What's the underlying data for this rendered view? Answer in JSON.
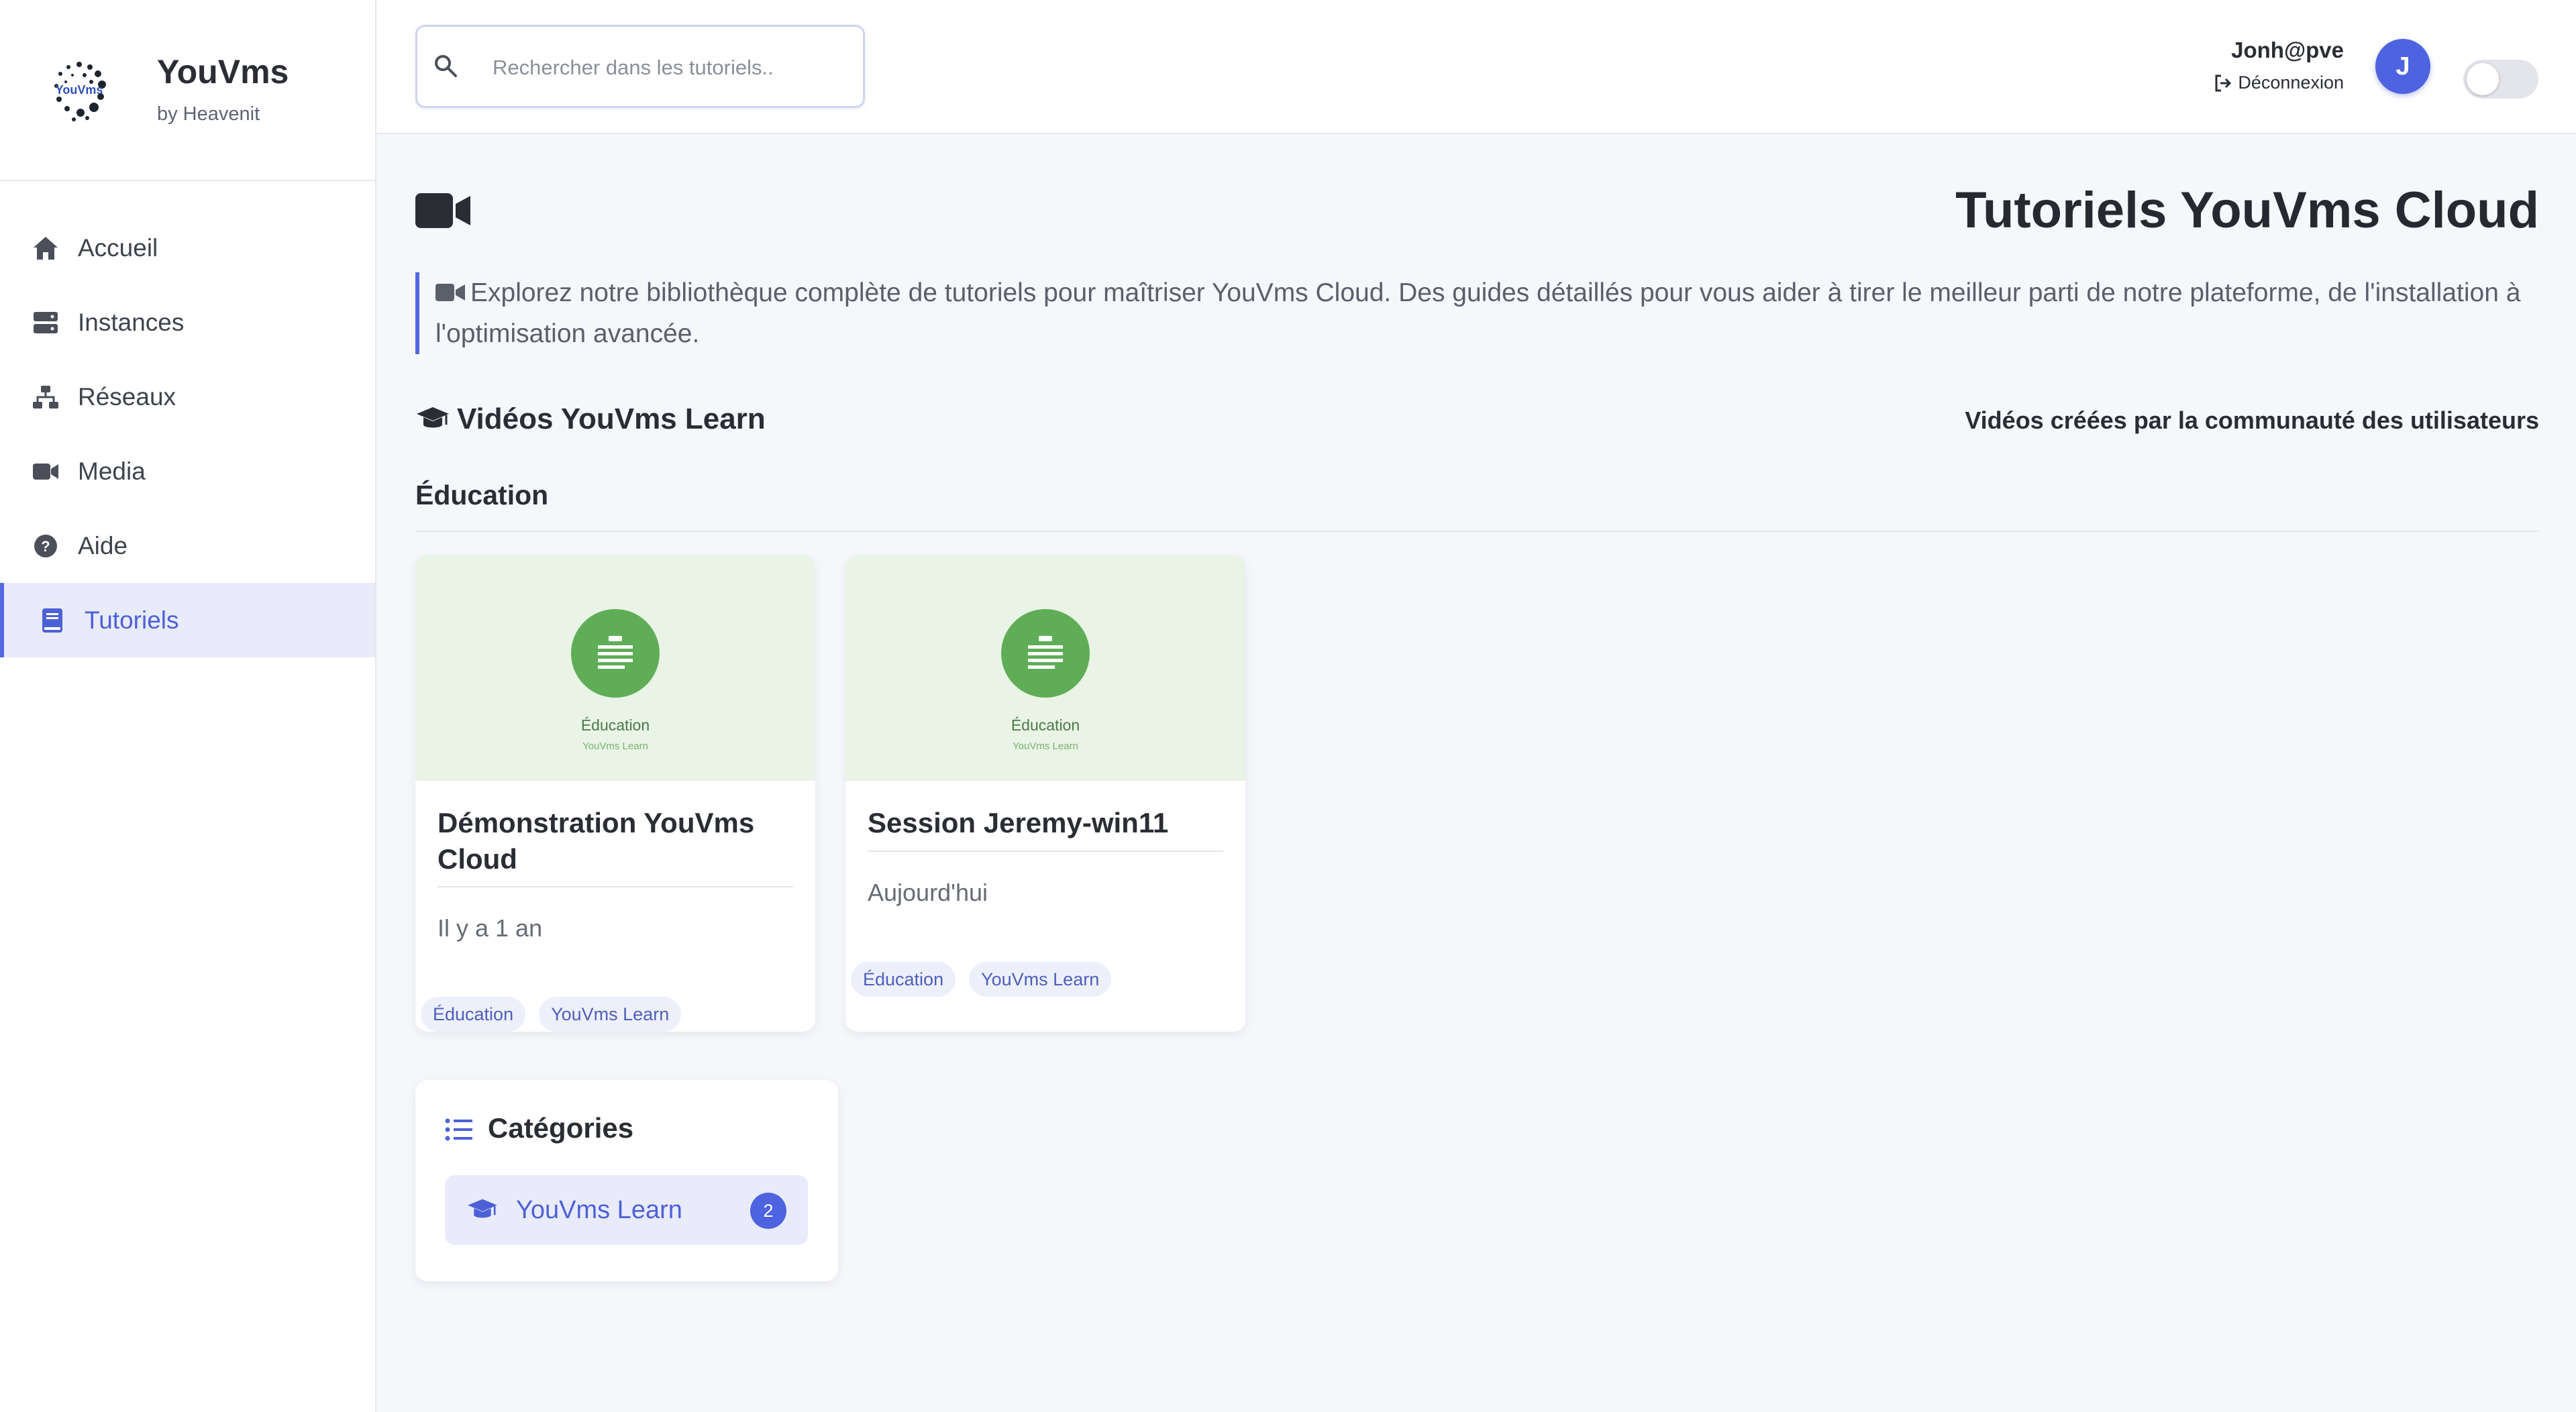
{
  "brand": {
    "name": "YouVms",
    "subtitle": "by Heavenit",
    "logo_text": "YouVms"
  },
  "sidebar": {
    "items": [
      {
        "label": "Accueil",
        "icon": "home-icon",
        "active": false
      },
      {
        "label": "Instances",
        "icon": "server-icon",
        "active": false
      },
      {
        "label": "Réseaux",
        "icon": "network-icon",
        "active": false
      },
      {
        "label": "Media",
        "icon": "video-icon",
        "active": false
      },
      {
        "label": "Aide",
        "icon": "help-icon",
        "active": false
      },
      {
        "label": "Tutoriels",
        "icon": "book-icon",
        "active": true
      }
    ]
  },
  "header": {
    "search": {
      "placeholder": "Rechercher dans les tutoriels..",
      "value": ""
    },
    "user": {
      "name": "Jonh@pve",
      "logout_label": "Déconnexion",
      "avatar_letter": "J"
    },
    "theme_toggle": {
      "on": false
    }
  },
  "main": {
    "title": "Tutoriels YouVms Cloud",
    "intro": "Explorez notre bibliothèque complète de tutoriels pour maîtriser YouVms Cloud. Des guides détaillés pour vous aider à tirer le meilleur parti de notre plateforme, de l'installation à l'optimisation avancée.",
    "section_title": "Vidéos YouVms Learn",
    "section_note": "Vidéos créées par la communauté des utilisateurs",
    "category_title": "Éducation",
    "cards": [
      {
        "thumb_category": "Éducation",
        "thumb_brand": "YouVms Learn",
        "title": "Démonstration YouVms Cloud",
        "date": "Il y a 1 an",
        "tags": [
          "Éducation",
          "YouVms Learn"
        ]
      },
      {
        "thumb_category": "Éducation",
        "thumb_brand": "YouVms Learn",
        "title": "Session Jeremy-win11",
        "date": "Aujourd'hui",
        "tags": [
          "Éducation",
          "YouVms Learn"
        ]
      }
    ],
    "categories_box": {
      "title": "Catégories",
      "items": [
        {
          "label": "YouVms Learn",
          "count": "2"
        }
      ]
    }
  },
  "colors": {
    "accent": "#4d63df",
    "active_bg": "#e9ebfb",
    "thumb_bg": "#e9f3e6",
    "thumb_circle": "#5fae57",
    "page_bg": "#f6f7fb"
  }
}
